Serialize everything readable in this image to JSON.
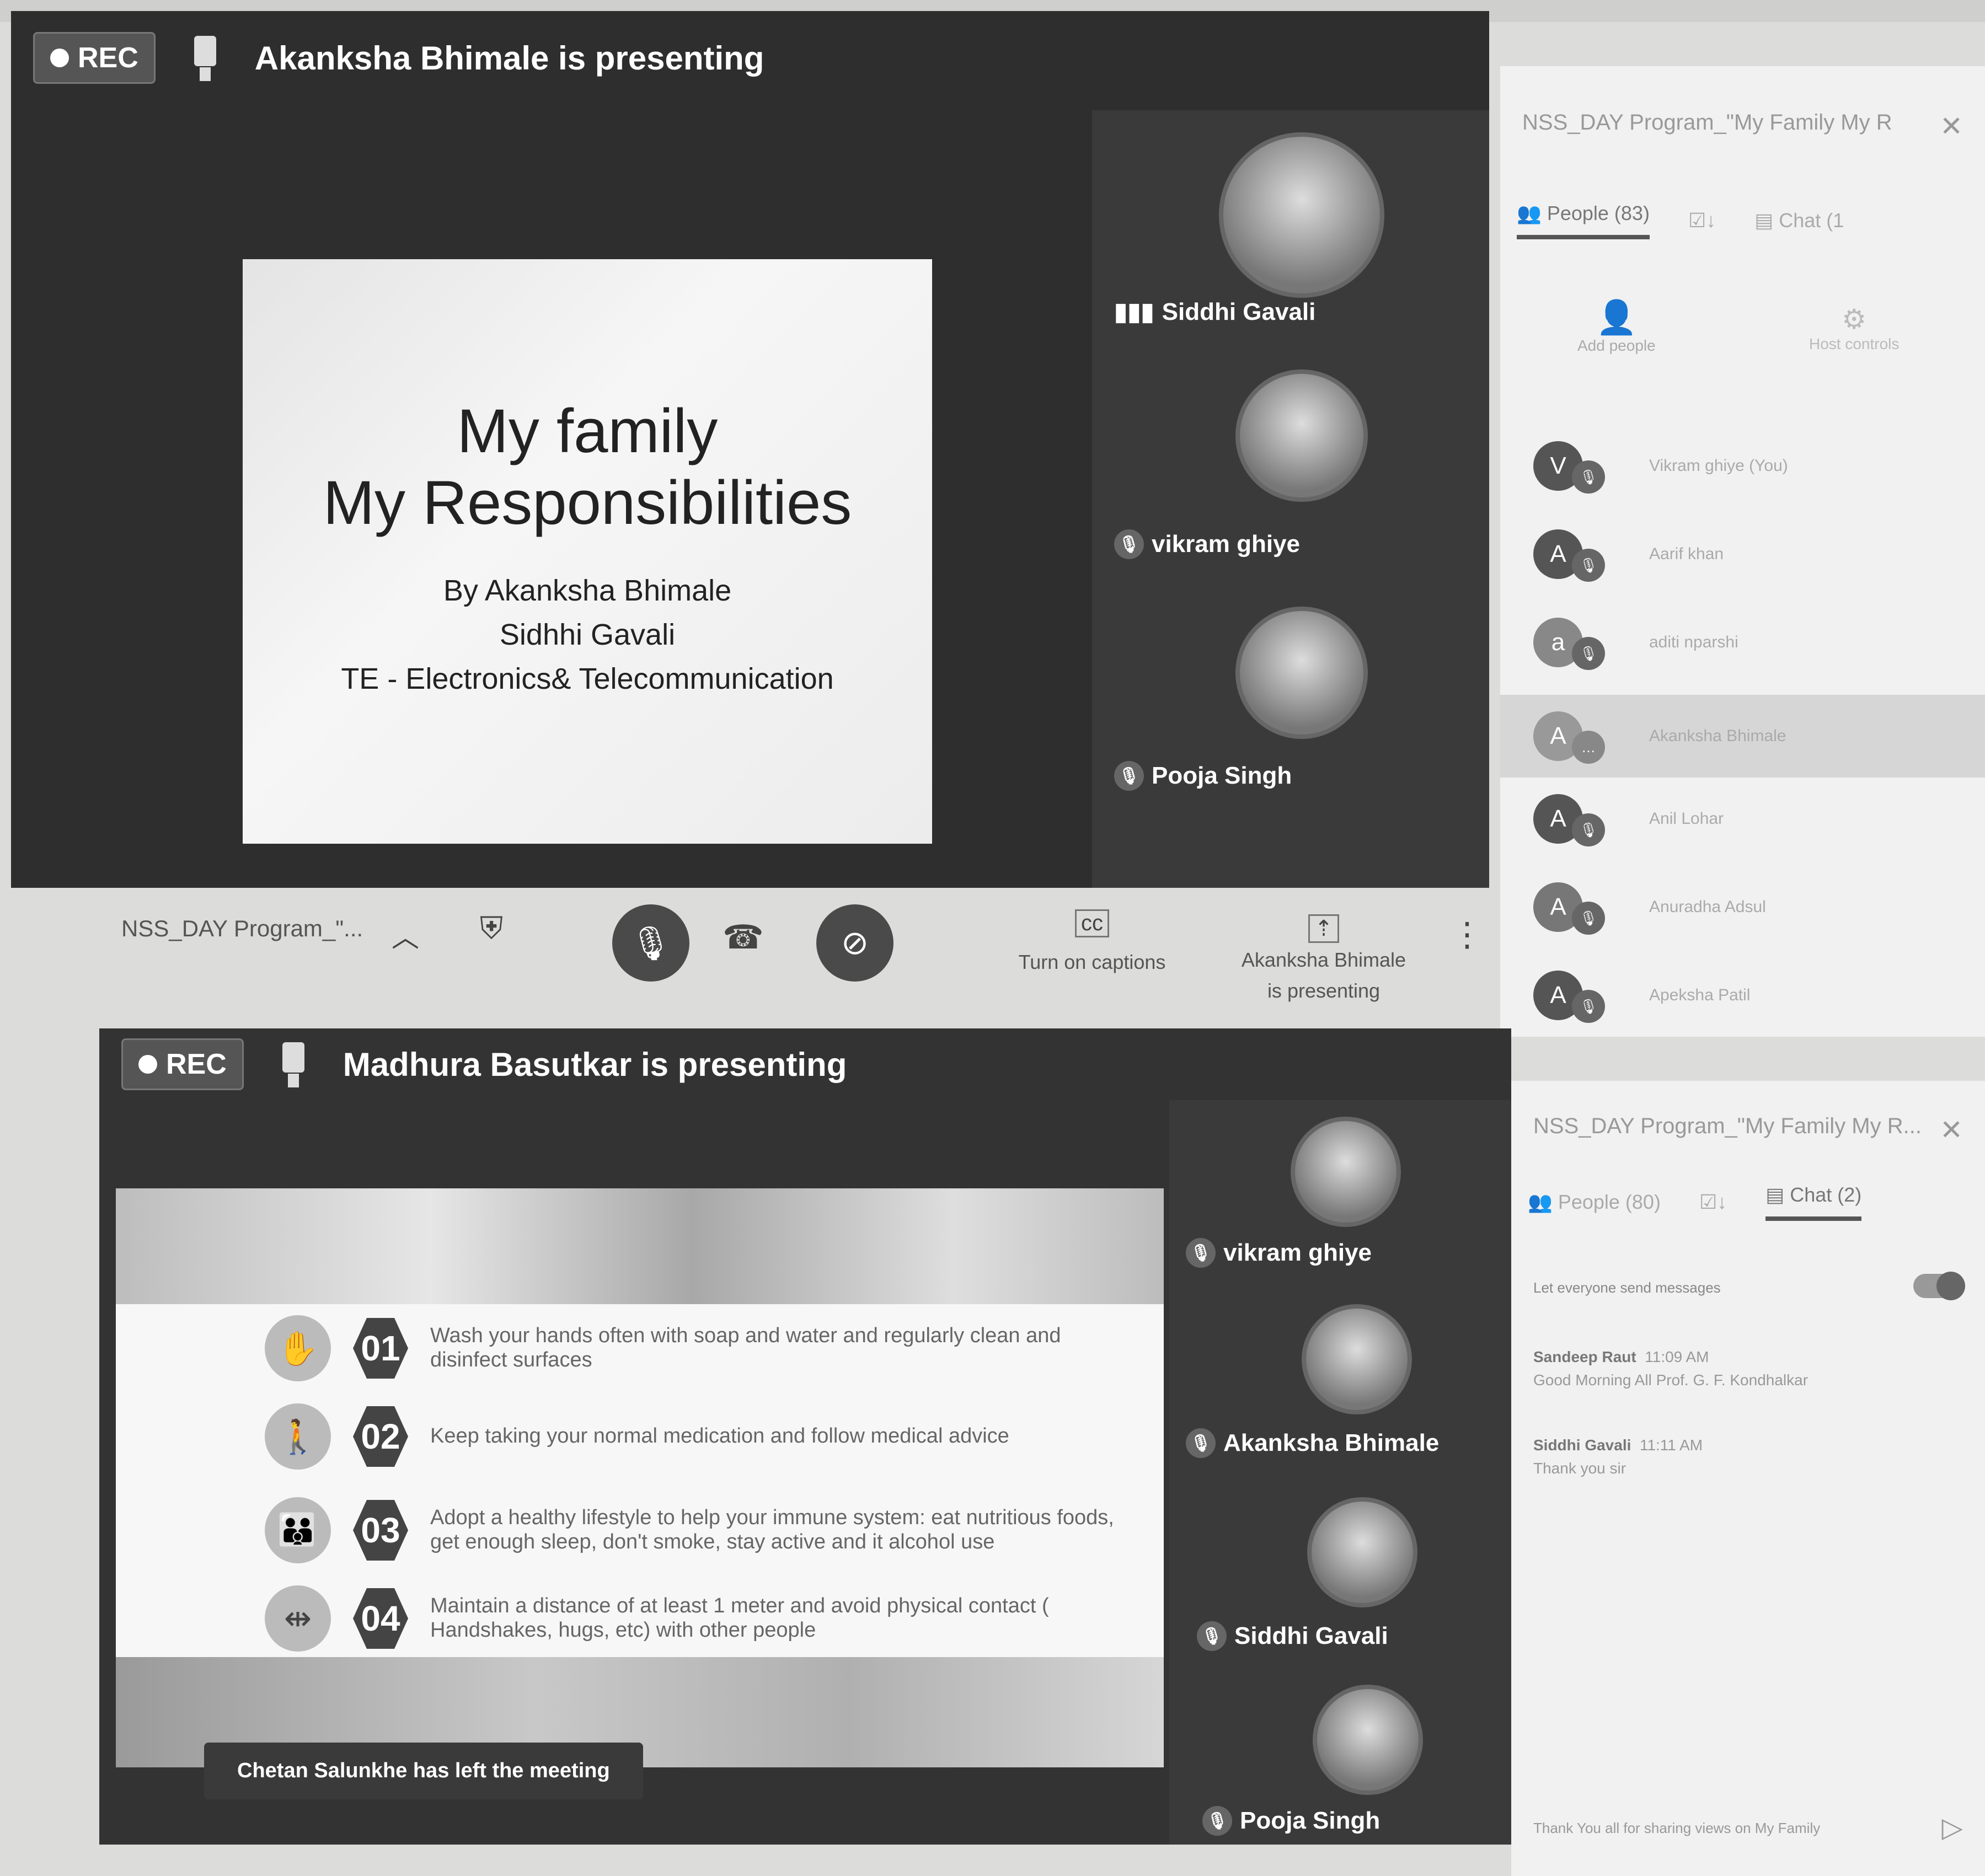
{
  "top_meeting": {
    "rec_label": "REC",
    "presenting_text": "Akanksha Bhimale is presenting",
    "slide": {
      "title_line1": "My family",
      "title_line2": "My Responsibilities",
      "by_line": "By  Akanksha Bhimale",
      "author2": "Sidhhi Gavali",
      "dept": "TE - Electronics& Telecommunication"
    },
    "tiles": [
      {
        "name": "Siddhi Gavali"
      },
      {
        "name": "vikram ghiye"
      },
      {
        "name": "Pooja Singh"
      }
    ]
  },
  "toolbar": {
    "meeting_name": "NSS_DAY Program_\"...",
    "captions_label": "Turn on captions",
    "presenting_line1": "Akanksha Bhimale",
    "presenting_line2": "is presenting"
  },
  "bottom_meeting": {
    "rec_label": "REC",
    "presenting_text": "Madhura Basutkar is presenting",
    "steps": [
      {
        "num": "01",
        "text": "Wash your hands often with soap and water and regularly clean and disinfect surfaces"
      },
      {
        "num": "02",
        "text": "Keep taking your normal medication and follow medical advice"
      },
      {
        "num": "03",
        "text": "Adopt a healthy lifestyle to help your immune system: eat nutritious foods, get enough sleep, don't smoke, stay active and it alcohol use"
      },
      {
        "num": "04",
        "text": "Maintain a distance of at least 1 meter and avoid physical contact ( Handshakes, hugs, etc) with other people"
      }
    ],
    "toast": "Chetan Salunkhe has left the meeting",
    "tiles": [
      {
        "name": "vikram ghiye"
      },
      {
        "name": "Akanksha Bhimale"
      },
      {
        "name": "Siddhi Gavali"
      },
      {
        "name": "Pooja Singh"
      }
    ]
  },
  "people_panel": {
    "title": "NSS_DAY Program_\"My Family My R",
    "tab_people": "People (83)",
    "tab_chat": "Chat (1",
    "add_people": "Add people",
    "host_controls": "Host controls",
    "people": [
      {
        "initial": "V",
        "name": "Vikram ghiye (You)"
      },
      {
        "initial": "A",
        "name": "Aarif khan"
      },
      {
        "initial": "a",
        "name": "aditi nparshi"
      },
      {
        "initial": "A",
        "name": "Akanksha Bhimale"
      },
      {
        "initial": "A",
        "name": "Anil Lohar"
      },
      {
        "initial": "A",
        "name": "Anuradha Adsul"
      },
      {
        "initial": "A",
        "name": "Apeksha Patil"
      }
    ]
  },
  "chat_panel": {
    "title": "NSS_DAY Program_\"My Family My R...",
    "tab_people": "People (80)",
    "tab_chat": "Chat (2)",
    "let_everyone": "Let everyone send messages",
    "messages": [
      {
        "sender": "Sandeep Raut",
        "time": "11:09 AM",
        "text": "Good Morning All   Prof. G. F. Kondhalkar"
      },
      {
        "sender": "Siddhi Gavali",
        "time": "11:11 AM",
        "text": "Thank you sir"
      }
    ],
    "input_text": "Thank You all for sharing views on My Family"
  }
}
